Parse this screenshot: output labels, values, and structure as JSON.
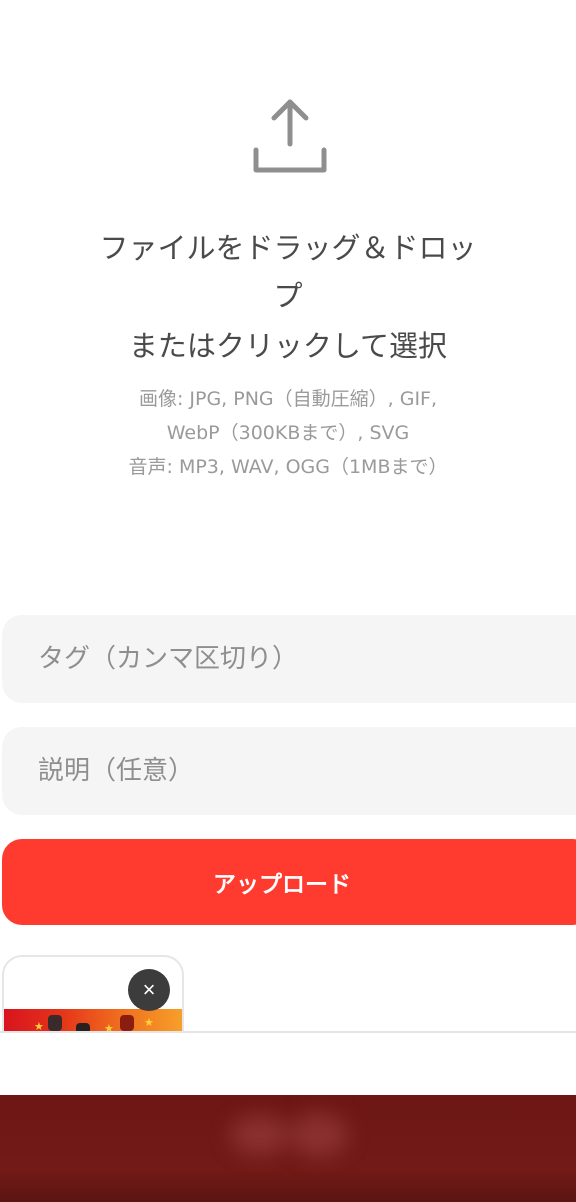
{
  "dropzone": {
    "icon": "upload-icon",
    "title": "ファイルをドラッグ＆ドロップ",
    "subtitle": "またはクリックして選択",
    "formats_line1": "画像: JPG, PNG（自動圧縮）, GIF,",
    "formats_line2": "WebP（300KBまで）, SVG",
    "formats_line3": "音声: MP3, WAV, OGG（1MBまで）"
  },
  "form": {
    "tags_placeholder": "タグ（カンマ区切り）",
    "description_placeholder": "説明（任意）",
    "upload_label": "アップロード"
  },
  "preview": {
    "remove_label": "×",
    "remove_icon": "close-icon"
  },
  "colors": {
    "accent": "#ff3b30",
    "field_background": "#f5f5f5",
    "banner": "#6d1715"
  }
}
